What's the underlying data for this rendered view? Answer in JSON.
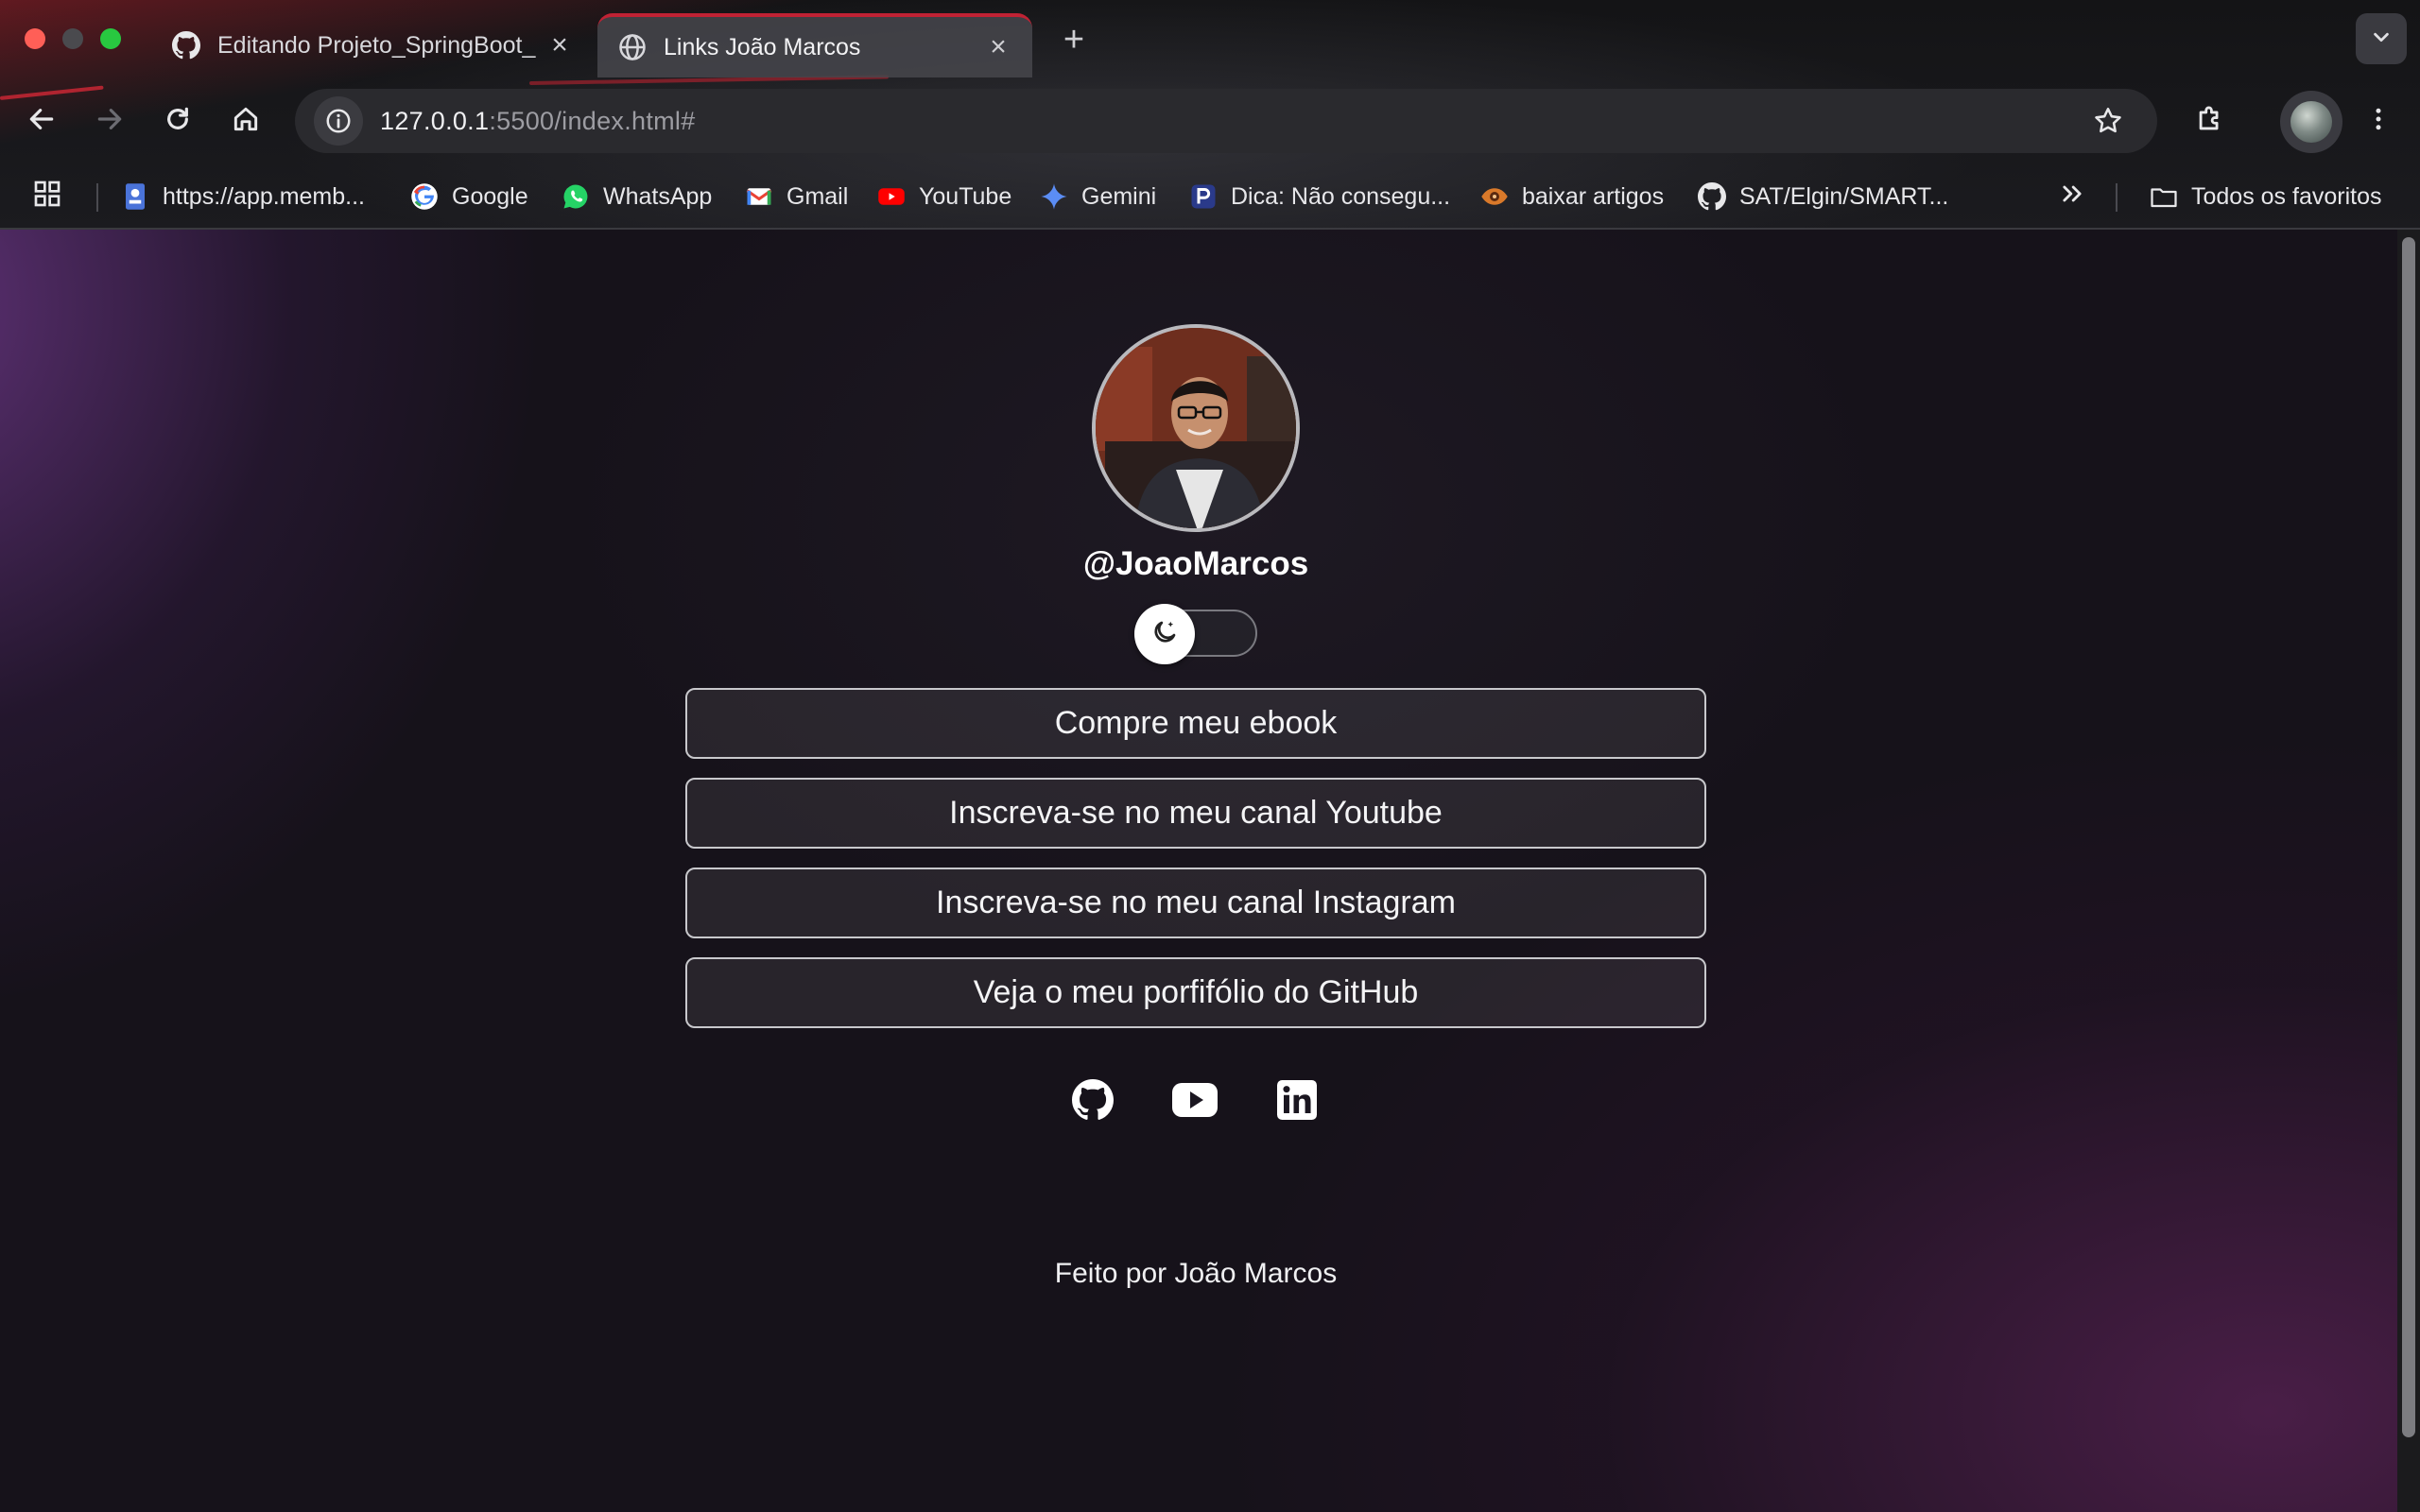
{
  "browser": {
    "tabs": [
      {
        "title": "Editando Projeto_SpringBoot_",
        "icon": "github-icon",
        "active": false
      },
      {
        "title": "Links João Marcos",
        "icon": "globe-icon",
        "active": true
      }
    ],
    "address": {
      "host": "127.0.0.1",
      "rest": ":5500/index.html#"
    },
    "bookmarks": [
      {
        "label": "https://app.memb...",
        "icon": "bookmark-page-icon"
      },
      {
        "label": "Google",
        "icon": "google-icon"
      },
      {
        "label": "WhatsApp",
        "icon": "whatsapp-icon"
      },
      {
        "label": "Gmail",
        "icon": "gmail-icon"
      },
      {
        "label": "YouTube",
        "icon": "youtube-icon"
      },
      {
        "label": "Gemini",
        "icon": "gemini-icon"
      },
      {
        "label": "Dica: Não consegu...",
        "icon": "p-icon"
      },
      {
        "label": "baixar artigos",
        "icon": "eye-icon"
      },
      {
        "label": "SAT/Elgin/SMART...",
        "icon": "github-icon"
      }
    ],
    "all_bookmarks_label": "Todos os favoritos"
  },
  "profile": {
    "username": "@JoaoMarcos",
    "theme_toggle": {
      "mode": "dark"
    }
  },
  "links": [
    {
      "label": "Compre meu ebook"
    },
    {
      "label": "Inscreva-se no meu canal Youtube"
    },
    {
      "label": "Inscreva-se no meu canal Instagram"
    },
    {
      "label": "Veja o meu porfifólio do GitHub"
    }
  ],
  "social_icons": [
    "github-icon",
    "youtube-icon",
    "linkedin-icon"
  ],
  "footer": {
    "text": "Feito por João Marcos"
  },
  "colors": {
    "page_background": "#161219",
    "accent_purple": "#7a3c96",
    "button_border": "#c8c8cc",
    "text": "#ffffff",
    "tab_accent": "#c02234"
  }
}
